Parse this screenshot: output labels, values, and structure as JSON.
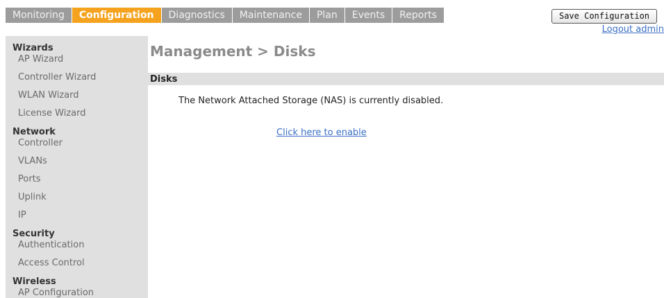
{
  "nav": {
    "tabs": [
      {
        "label": "Monitoring",
        "active": false
      },
      {
        "label": "Configuration",
        "active": true
      },
      {
        "label": "Diagnostics",
        "active": false
      },
      {
        "label": "Maintenance",
        "active": false
      },
      {
        "label": "Plan",
        "active": false
      },
      {
        "label": "Events",
        "active": false
      },
      {
        "label": "Reports",
        "active": false
      }
    ],
    "save_label": "Save Configuration",
    "logout_label": "Logout admin"
  },
  "sidebar": {
    "sections": [
      {
        "heading": "Wizards",
        "items": [
          "AP Wizard",
          "Controller Wizard",
          "WLAN Wizard",
          "License Wizard"
        ]
      },
      {
        "heading": "Network",
        "items": [
          "Controller",
          "VLANs",
          "Ports",
          "Uplink",
          "IP"
        ]
      },
      {
        "heading": "Security",
        "items": [
          "Authentication",
          "Access Control"
        ]
      },
      {
        "heading": "Wireless",
        "items": [
          "AP Configuration"
        ]
      }
    ]
  },
  "main": {
    "title": "Management > Disks",
    "section_label": "Disks",
    "nas_message": "The Network Attached Storage (NAS) is currently disabled.",
    "enable_link": "Click here to enable"
  },
  "colors": {
    "accent": "#f5a31e",
    "tab_bg": "#9c9c9c",
    "sidebar_bg": "#e0e0e0",
    "link": "#3a6fc4"
  }
}
